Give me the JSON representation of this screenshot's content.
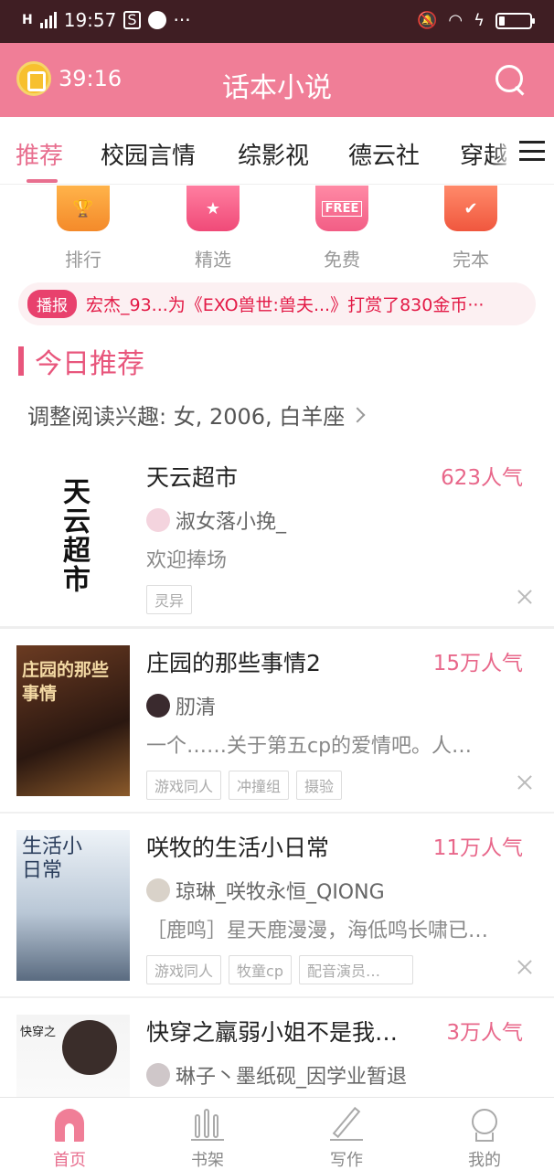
{
  "status_bar": {
    "signal": "H",
    "time": "19:57",
    "dots": "···"
  },
  "app_bar": {
    "timer": "39:16",
    "title": "话本小说"
  },
  "tabs": [
    {
      "label": "推荐",
      "active": true
    },
    {
      "label": "校园言情"
    },
    {
      "label": "综影视"
    },
    {
      "label": "德云社"
    },
    {
      "label": "穿越"
    }
  ],
  "categories": [
    {
      "label": "排行",
      "icon": "trophy-icon"
    },
    {
      "label": "精选",
      "icon": "star-icon"
    },
    {
      "label": "免费",
      "icon": "free-icon",
      "badge": "FREE"
    },
    {
      "label": "完本",
      "icon": "check-icon"
    }
  ],
  "broadcast": {
    "badge": "播报",
    "text": "宏杰_93...为《EXO兽世:兽夫...》打赏了830金币···"
  },
  "section": {
    "title": "今日推荐",
    "interest": "调整阅读兴趣: 女, 2006, 白羊座"
  },
  "books": [
    {
      "title": "天云超市",
      "popularity": "623人气",
      "author": "淑女落小挽_",
      "desc": "欢迎捧场",
      "tags": [
        "灵异"
      ],
      "cover_text": "天云超市"
    },
    {
      "title": "庄园的那些事情2",
      "popularity": "15万人气",
      "author": "肕清",
      "desc": "一个……关于第五cp的爱情吧。人…",
      "tags": [
        "游戏同人",
        "冲撞组",
        "摄验"
      ],
      "cover_text": "庄园的那些事情"
    },
    {
      "title": "咲牧的生活小日常",
      "popularity": "11万人气",
      "author": "琼琳_咲牧永恒_QIONG",
      "desc": "［鹿鸣］星天鹿漫漫，海低鸣长啸已…",
      "tags": [
        "游戏同人",
        "牧童cp",
        "配音演员…"
      ],
      "cover_text": "生活小日常"
    },
    {
      "title": "快穿之羸弱小姐不是我…",
      "popularity": "3万人气",
      "author": "琳子丶墨纸砚_因学业暂退",
      "desc": "",
      "tags": [],
      "cover_text": "快穿之"
    }
  ],
  "bottom_nav": [
    {
      "label": "首页",
      "active": true,
      "icon": "home-icon"
    },
    {
      "label": "书架",
      "icon": "bookshelf-icon"
    },
    {
      "label": "写作",
      "icon": "pen-icon"
    },
    {
      "label": "我的",
      "icon": "profile-icon"
    }
  ],
  "colors": {
    "accent": "#f07e97",
    "status_bar": "#3f1e23",
    "broadcast_text": "#e31a46"
  }
}
